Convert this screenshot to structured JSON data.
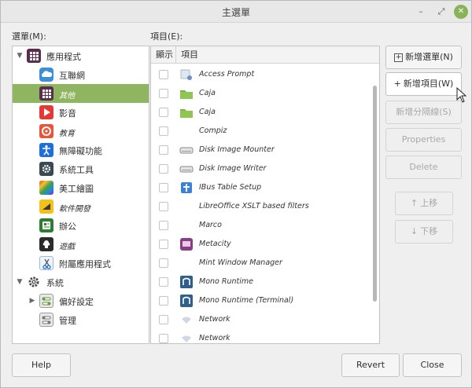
{
  "window": {
    "title": "主選單",
    "minimize_glyph": "–",
    "maximize_glyph": "⤢",
    "close_glyph": "✕"
  },
  "menu_label": "選單(M):",
  "items_label": "項目(E):",
  "tree": {
    "root": "應用程式",
    "children": [
      "互聯網",
      "其他",
      "影音",
      "教育",
      "無障礙功能",
      "系統工具",
      "美工繪圖",
      "軟件開發",
      "辦公",
      "遊戲",
      "附屬應用程式"
    ],
    "system": "系統",
    "system_children": [
      "偏好設定",
      "管理"
    ]
  },
  "table": {
    "col_show": "顯示",
    "col_item": "項目",
    "rows": [
      "Access Prompt",
      "Caja",
      "Caja",
      "Compiz",
      "Disk Image Mounter",
      "Disk Image Writer",
      "IBus Table Setup",
      "LibreOffice XSLT based filters",
      "Marco",
      "Metacity",
      "Mint Window Manager",
      "Mono Runtime",
      "Mono Runtime (Terminal)",
      "Network",
      "Network"
    ]
  },
  "buttons": {
    "new_menu": "新增選單(N)",
    "new_item": "新增項目(W)",
    "new_separator": "新增分隔線(S)",
    "properties": "Properties",
    "delete": "Delete",
    "move_up": "上移",
    "move_down": "下移",
    "help": "Help",
    "revert": "Revert",
    "close": "Close"
  },
  "colors": {
    "selection": "#8fb560",
    "close_button": "#8ab359"
  }
}
